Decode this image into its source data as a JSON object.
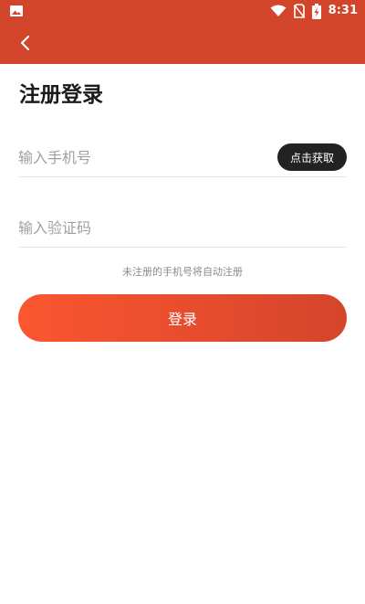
{
  "status_bar": {
    "time": "8:31",
    "icons": [
      "image-notification-icon",
      "wifi-icon",
      "no-sim-icon",
      "battery-charging-icon"
    ]
  },
  "toolbar": {
    "back_icon": "chevron-left-icon"
  },
  "page": {
    "title": "注册登录"
  },
  "form": {
    "phone_placeholder": "输入手机号",
    "phone_value": "",
    "get_code_label": "点击获取",
    "code_placeholder": "输入验证码",
    "code_value": "",
    "hint": "未注册的手机号将自动注册",
    "login_label": "登录"
  },
  "colors": {
    "accent": "#d2452a",
    "button_start": "#fb5630",
    "button_end": "#d4452b",
    "get_code_bg": "#222222"
  }
}
